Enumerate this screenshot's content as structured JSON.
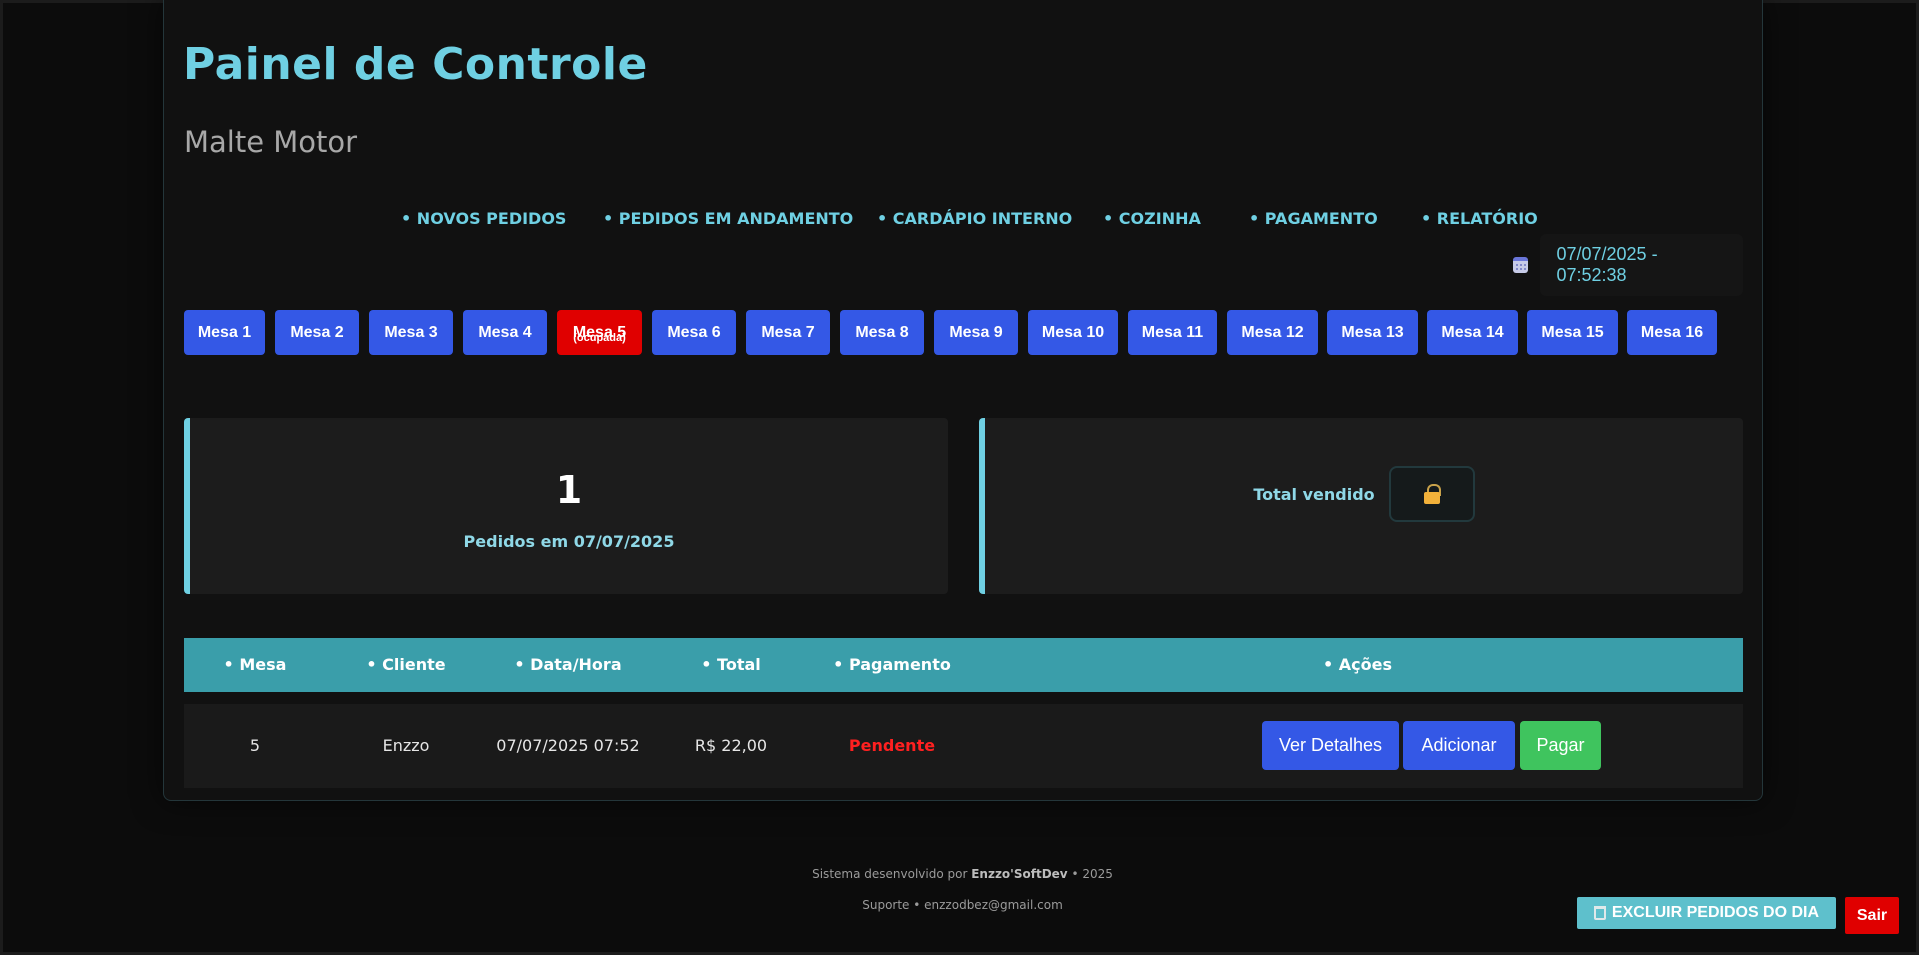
{
  "header": {
    "title": "Painel de Controle",
    "subtitle": "Malte Motor"
  },
  "nav": {
    "items": [
      "• NOVOS PEDIDOS",
      "• PEDIDOS EM ANDAMENTO",
      "• CARDÁPIO INTERNO",
      "• COZINHA",
      "• PAGAMENTO",
      "• RELATÓRIO"
    ]
  },
  "datetime": {
    "icon": "calendar-icon",
    "value": "07/07/2025 - 07:52:38"
  },
  "tables": {
    "items": [
      "Mesa 1",
      "Mesa 2",
      "Mesa 3",
      "Mesa 4",
      "Mesa 5",
      "Mesa 6",
      "Mesa 7",
      "Mesa 8",
      "Mesa 9",
      "Mesa 10",
      "Mesa 11",
      "Mesa 12",
      "Mesa 13",
      "Mesa 14",
      "Mesa 15",
      "Mesa 16"
    ],
    "occupied_label": "(ocupada)",
    "occupied_index": 4
  },
  "stats": {
    "orders_count": "1",
    "orders_label": "Pedidos em 07/07/2025",
    "total_label": "Total vendido",
    "total_icon": "lock-icon"
  },
  "orders_table": {
    "headers": [
      "• Mesa",
      "• Cliente",
      "• Data/Hora",
      "• Total",
      "• Pagamento",
      "• Ações"
    ],
    "rows": [
      {
        "mesa": "5",
        "cliente": "Enzzo",
        "data_hora": "07/07/2025 07:52",
        "total": "R$ 22,00",
        "pagamento": "Pendente",
        "actions": [
          "Ver Detalhes",
          "Adicionar",
          "Pagar"
        ]
      }
    ]
  },
  "footer": {
    "line1_prefix": "Sistema desenvolvido por",
    "line1_brand": "Enzzo'SoftDev",
    "line1_suffix": "• 2025",
    "line2": "Suporte • enzzodbez@gmail.com"
  },
  "buttons": {
    "delete_day": "EXCLUIR PEDIDOS DO DIA",
    "logout": "Sair"
  },
  "colors": {
    "accent": "#6fd0e3",
    "primary": "#3458e6",
    "danger": "#e00000",
    "success": "#3fc45e",
    "table_header": "#3a9eaa"
  }
}
